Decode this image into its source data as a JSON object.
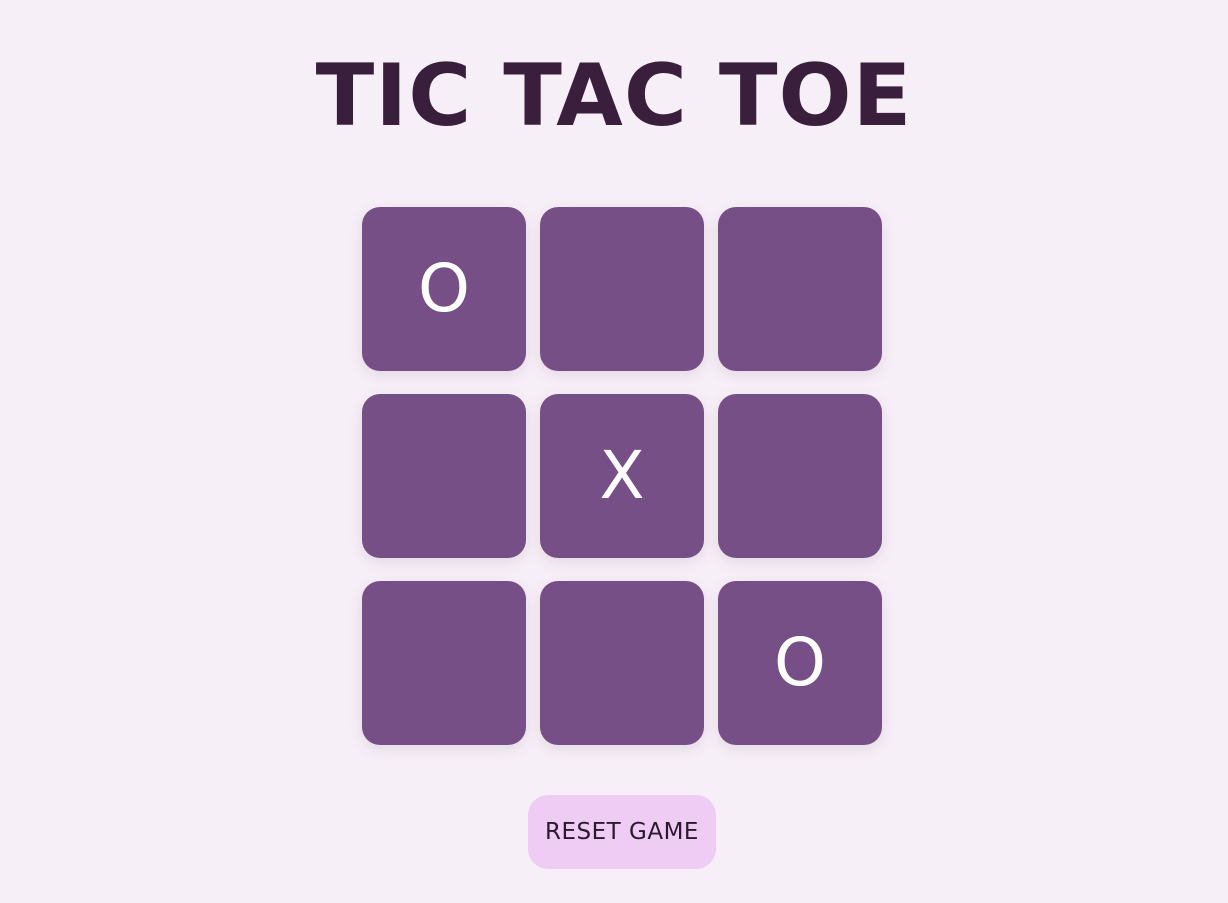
{
  "title": "TIC TAC TOE",
  "board": {
    "cells": [
      "O",
      "",
      "",
      "",
      "X",
      "",
      "",
      "",
      "O"
    ]
  },
  "reset_label": "RESET GAME",
  "colors": {
    "background": "#f7eff7",
    "title": "#3a1f3c",
    "cell": "#774f87",
    "mark": "#ffffff",
    "reset_button": "#efccf4"
  }
}
